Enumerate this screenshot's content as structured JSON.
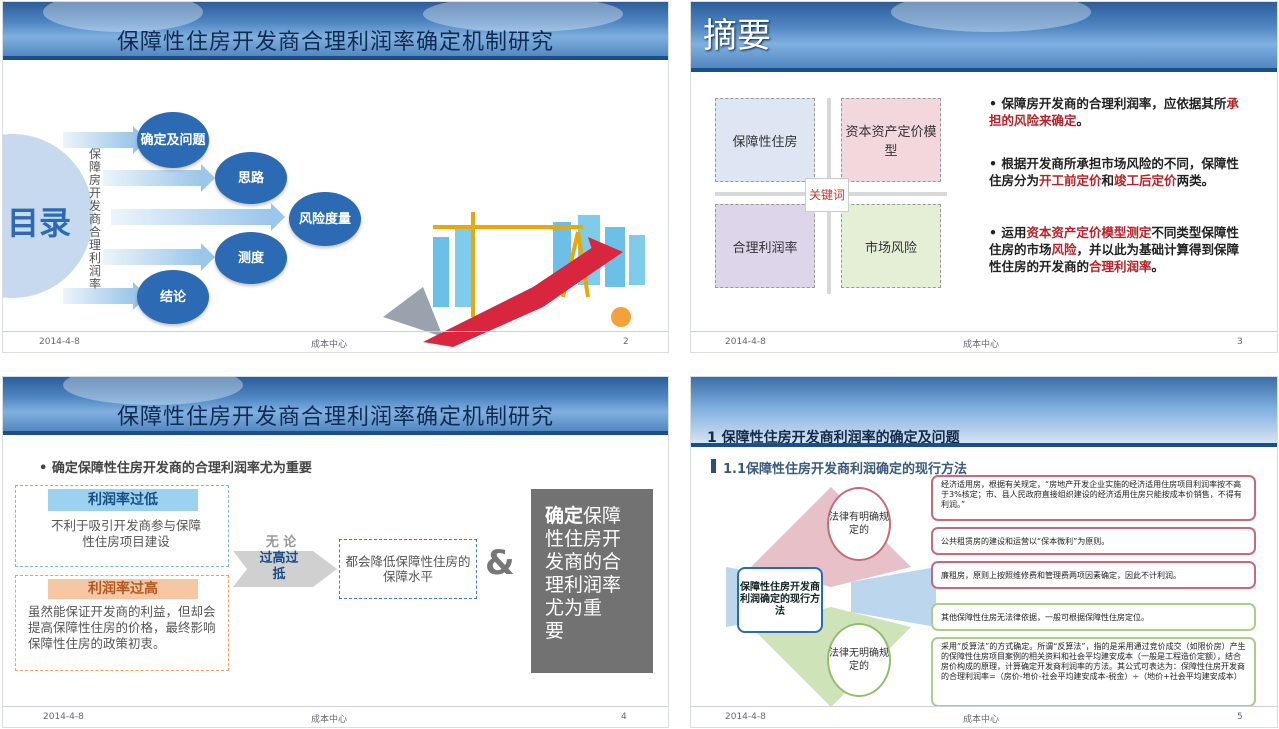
{
  "slide1": {
    "title": "保障性住房开发商合理利润率确定机制研究",
    "menu_label": "目录",
    "vertical_text": "保障房开发商合理利润率",
    "circles": [
      "确定及问题",
      "思路",
      "风险度量",
      "测度",
      "结论"
    ],
    "footer": {
      "date": "2014-4-8",
      "center": "成本中心",
      "page": "2"
    }
  },
  "slide2": {
    "title": "摘要",
    "quadrants": [
      "保障性住房",
      "资本资产定价模型",
      "合理利润率",
      "市场风险"
    ],
    "center_label": "关键词",
    "bullets": [
      {
        "pre": "• 保障房开发商的合理利润率，应依据其所",
        "hl": "承担的风险来确定",
        "post": "。"
      },
      {
        "pre": "• 根据开发商所承担市场风险的不同，保障性住房分为",
        "hl": "开工前定价",
        "mid": "和",
        "hl2": "竣工后定价",
        "post": "两类。"
      },
      {
        "pre": "• 运用",
        "hl": "资本资产定价模型测定",
        "mid": "不同类型保障性住房的市场",
        "hl2": "风险",
        "post": "，并以此为基础计算得到保障性住房的开发商的",
        "hl3": "合理利润率",
        "post2": "。"
      }
    ],
    "footer": {
      "date": "2014-4-8",
      "center": "成本中心",
      "page": "3"
    }
  },
  "slide3": {
    "title": "保障性住房开发商合理利润率确定机制研究",
    "subtitle": "• 确定保障性住房开发商的合理利润率尤为重要",
    "low_header": "利润率过低",
    "low_text": "不利于吸引开发商参与保障性住房项目建设",
    "high_header": "利润率过高",
    "high_text": "虽然能保证开发商的利益，但却会提高保障性住房的价格，最终影响保障性住房的政策初衷。",
    "arrow_top": "无 论",
    "arrow_main": "过高过抵",
    "result": "都会降低保障性住房的保障水平",
    "amp": "&",
    "conclusion_bold": "确定",
    "conclusion_rest": "保障性住房开发商的合理利润率尤为重　要",
    "footer": {
      "date": "2014-4-8",
      "center": "成本中心",
      "page": "4"
    }
  },
  "slide4": {
    "title": "1  保障性住房开发商利润率的确定及问题",
    "section": "1.1保障性住房开发商利润确定的现行方法",
    "center_box": "保障性住房开发商利润确定的现行方法",
    "upper_label": "法律有明确规定的",
    "lower_label": "法律无明确规定的",
    "pills": [
      "经济适用房，根据有关规定，“房地产开发企业实施的经济适用住房项目利润率按不高于3%核定；市、县人民政府直接组织建设的经济适用住房只能按成本价销售，不得有利润。”",
      "公共租赁房的建设和运营以“保本微利”为原则。",
      "廉租房，原则上按照维修费和管理费两项因素确定，因此不计利润。",
      "其他保障性住房无法律依据，一般可根据保障性住房定位。",
      "采用“反算法”的方式确定。所谓“反算法”，指的是采用通过竞价成交（如限价房）产生的保障性住房项目案例的相关资料和社会平均建安成本（一般是工程造价定额），结合房价构成的原理，计算确定开发商利润率的方法。其公式可表达为：保障性住房开发商的合理利润率=（房价-地价-社会平均建安成本-税金）÷（地价+社会平均建安成本）"
    ],
    "footer": {
      "date": "2014-4-8",
      "center": "成本中心",
      "page": "5"
    }
  }
}
